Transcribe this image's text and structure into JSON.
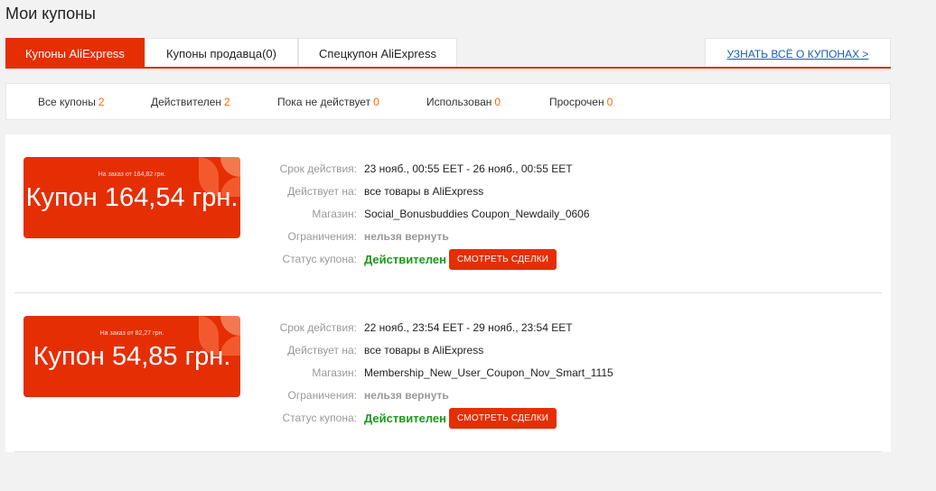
{
  "page": {
    "title": "Мои купоны"
  },
  "tabs": [
    {
      "label": "Купоны AliExpress",
      "active": true
    },
    {
      "label": "Купоны продавца(0)",
      "active": false
    },
    {
      "label": "Спецкупон AliExpress",
      "active": false
    }
  ],
  "learn_link": "УЗНАТЬ ВСЁ О КУПОНАХ >",
  "filters": [
    {
      "label": "Все купоны",
      "count": "2"
    },
    {
      "label": "Действителен",
      "count": "2"
    },
    {
      "label": "Пока не действует",
      "count": "0"
    },
    {
      "label": "Использован",
      "count": "0"
    },
    {
      "label": "Просрочен",
      "count": "0"
    }
  ],
  "labels": {
    "validity": "Срок действия:",
    "applies": "Действует на:",
    "store": "Магазин:",
    "limits": "Ограничения:",
    "status": "Статус купона:",
    "deals_button": "СМОТРЕТЬ СДЕЛКИ"
  },
  "coupons": [
    {
      "min_order": "На заказ от 164,82 грн.",
      "amount": "Купон 164,54 грн.",
      "validity": "23 нояб., 00:55 EET - 26 нояб., 00:55 EET",
      "applies": "все товары в AliExpress",
      "store": "Social_Bonusbuddies Coupon_Newdaily_0606",
      "limits": "нельзя вернуть",
      "status": "Действителен"
    },
    {
      "min_order": "На заказ от 82,27 грн.",
      "amount": "Купон 54,85 грн.",
      "validity": "22 нояб., 23:54 EET - 29 нояб., 23:54 EET",
      "applies": "все товары в AliExpress",
      "store": "Membership_New_User_Coupon_Nov_Smart_1115",
      "limits": "нельзя вернуть",
      "status": "Действителен"
    }
  ],
  "colors": {
    "accent": "#e62e04",
    "count": "#ff6600",
    "status_ok": "#1a9a1a",
    "link": "#1a5db5"
  },
  "icons": {
    "ticket_corner": "coupon-corner-decoration"
  }
}
